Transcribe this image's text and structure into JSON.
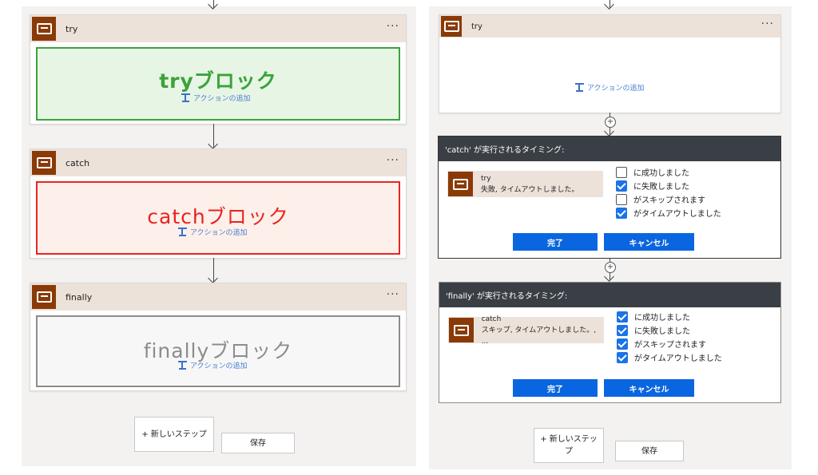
{
  "left": {
    "scopes": [
      {
        "title": "try",
        "block_label": "tryブロック",
        "add_action": "アクションの追加",
        "color": "#3aa33a"
      },
      {
        "title": "catch",
        "block_label": "catchブロック",
        "add_action": "アクションの追加",
        "color": "#e8241f"
      },
      {
        "title": "finally",
        "block_label": "finallyブロック",
        "add_action": "アクションの追加",
        "color": "#8c8c8c"
      }
    ],
    "menu": "···",
    "new_step": "+ 新しいステップ",
    "save": "保存"
  },
  "right": {
    "scope_try": {
      "title": "try",
      "add_action": "アクションの追加",
      "menu": "···"
    },
    "catch_dialog": {
      "header": "'catch' が実行されるタイミング:",
      "predecessor": {
        "title": "try",
        "status": "失敗, タイムアウトしました。"
      },
      "options": [
        {
          "label": "に成功しました",
          "checked": false
        },
        {
          "label": "に失敗しました",
          "checked": true
        },
        {
          "label": "がスキップされます",
          "checked": false
        },
        {
          "label": "がタイムアウトしました",
          "checked": true
        }
      ],
      "done": "完了",
      "cancel": "キャンセル"
    },
    "finally_dialog": {
      "header": "'finally' が実行されるタイミング:",
      "predecessor": {
        "title": "catch",
        "status": "スキップ, タイムアウトしました。, ..."
      },
      "options": [
        {
          "label": "に成功しました",
          "checked": true
        },
        {
          "label": "に失敗しました",
          "checked": true
        },
        {
          "label": "がスキップされます",
          "checked": true
        },
        {
          "label": "がタイムアウトしました",
          "checked": true
        }
      ],
      "done": "完了",
      "cancel": "キャンセル"
    },
    "new_step": "+ 新しいステップ",
    "save": "保存"
  },
  "colors": {
    "scope_icon": "#8a3a06",
    "scope_header": "#ede2da",
    "dialog_header": "#3a3f46",
    "primary_button": "#0a66e0"
  }
}
